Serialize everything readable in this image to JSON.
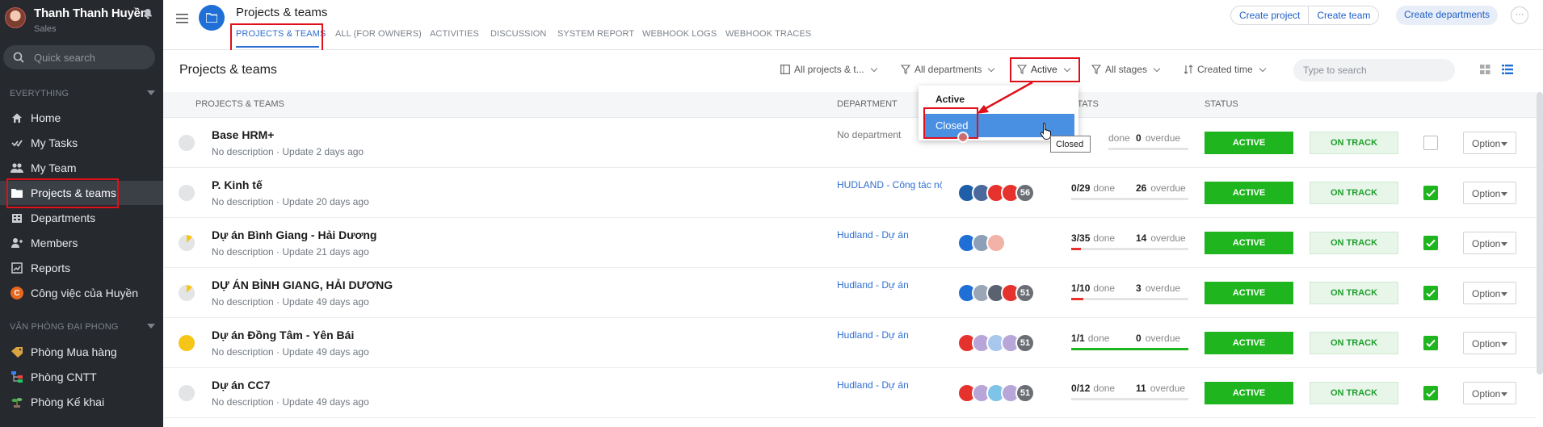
{
  "user": {
    "name": "Thanh Thanh Huyền",
    "role": "Sales"
  },
  "sidebar": {
    "search_placeholder": "Quick search",
    "section1": "EVERYTHING",
    "items": [
      {
        "label": "Home",
        "icon": "home-icon"
      },
      {
        "label": "My Tasks",
        "icon": "tasks-icon"
      },
      {
        "label": "My Team",
        "icon": "team-icon"
      },
      {
        "label": "Projects & teams",
        "icon": "folder-icon"
      },
      {
        "label": "Departments",
        "icon": "departments-icon"
      },
      {
        "label": "Members",
        "icon": "members-icon"
      },
      {
        "label": "Reports",
        "icon": "reports-icon"
      },
      {
        "label": "Công việc của Huyền",
        "icon": "personal-c-icon"
      }
    ],
    "section2": "VĂN PHÒNG ĐẠI PHONG",
    "items2": [
      {
        "label": "Phòng Mua hàng",
        "icon": "tag-icon"
      },
      {
        "label": "Phòng CNTT",
        "icon": "org-chart-icon"
      },
      {
        "label": "Phòng Kế khai",
        "icon": "plant-icon"
      }
    ]
  },
  "header": {
    "title": "Projects & teams",
    "tabs": [
      "PROJECTS & TEAMS",
      "ALL (FOR OWNERS)",
      "ACTIVITIES",
      "DISCUSSION",
      "SYSTEM REPORT",
      "WEBHOOK LOGS",
      "WEBHOOK TRACES"
    ],
    "create_project": "Create project",
    "create_team": "Create team",
    "create_departments": "Create departments",
    "more": "···"
  },
  "filters": {
    "title": "Projects & teams",
    "scope": "All projects & t...",
    "departments": "All departments",
    "status": "Active",
    "stages": "All stages",
    "sort": "Created time",
    "search_placeholder": "Type to search"
  },
  "dropdown": {
    "options": [
      "Active",
      "Closed"
    ],
    "highlighted": "Closed",
    "tooltip": "Closed"
  },
  "table": {
    "headers": {
      "name": "PROJECTS & TEAMS",
      "department": "DEPARTMENT",
      "stats": "STATS",
      "status": "STATUS"
    },
    "rows": [
      {
        "name": "Base HRM+",
        "desc": "No description · Update 2 days ago",
        "dept": "No department",
        "done": "",
        "total": "",
        "done_label": "done",
        "overdue": "0",
        "overdue_label": "overdue",
        "progress": 0,
        "status": "ACTIVE",
        "track": "ON TRACK",
        "checked": false,
        "option": "Option",
        "dot_color": "#e3e4e6"
      },
      {
        "name": "P. Kinh tế",
        "desc": "No description · Update 20 days ago",
        "dept": "HUDLAND - Công tác nội",
        "done": "0",
        "total": "29",
        "done_label": "done",
        "overdue": "26",
        "overdue_label": "overdue",
        "progress": 0,
        "status": "ACTIVE",
        "track": "ON TRACK",
        "checked": true,
        "option": "Option",
        "dot_color": "#e3e4e6",
        "avatar_count": "56"
      },
      {
        "name": "Dự án Bình Giang - Hải Dương",
        "desc": "No description · Update 21 days ago",
        "dept": "Hudland - Dự án",
        "done": "3",
        "total": "35",
        "done_label": "done",
        "overdue": "14",
        "overdue_label": "overdue",
        "progress": 0.086,
        "status": "ACTIVE",
        "track": "ON TRACK",
        "checked": true,
        "option": "Option",
        "dot_color": "#e3e4e6"
      },
      {
        "name": "DỰ ÁN BÌNH GIANG, HẢI DƯƠNG",
        "desc": "No description · Update 49 days ago",
        "dept": "Hudland - Dự án",
        "done": "1",
        "total": "10",
        "done_label": "done",
        "overdue": "3",
        "overdue_label": "overdue",
        "progress": 0.1,
        "status": "ACTIVE",
        "track": "ON TRACK",
        "checked": true,
        "option": "Option",
        "dot_color": "#e3e4e6",
        "avatar_count": "51"
      },
      {
        "name": "Dự án Đồng Tâm - Yên Bái",
        "desc": "No description · Update 49 days ago",
        "dept": "Hudland - Dự án",
        "done": "1",
        "total": "1",
        "done_label": "done",
        "overdue": "0",
        "overdue_label": "overdue",
        "progress": 1,
        "status": "ACTIVE",
        "track": "ON TRACK",
        "checked": true,
        "option": "Option",
        "dot_color": "#f5c518",
        "avatar_count": "51"
      },
      {
        "name": "Dự án CC7",
        "desc": "No description · Update 49 days ago",
        "dept": "Hudland - Dự án",
        "done": "0",
        "total": "12",
        "done_label": "done",
        "overdue": "11",
        "overdue_label": "overdue",
        "progress": 0,
        "status": "ACTIVE",
        "track": "ON TRACK",
        "checked": true,
        "option": "Option",
        "dot_color": "#e3e4e6",
        "avatar_count": "51"
      }
    ]
  },
  "colors": {
    "accent": "#2f6fd1",
    "status_active": "#1fb51f",
    "annotation": "#e0101a",
    "sidebar_bg": "#26292e"
  }
}
